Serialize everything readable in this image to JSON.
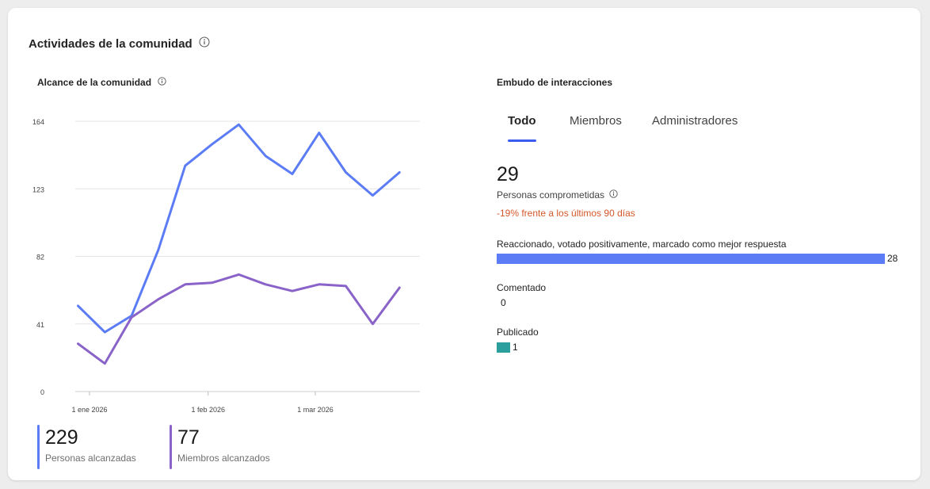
{
  "card": {
    "title": "Actividades de la comunidad"
  },
  "reach": {
    "title": "Alcance de la comunidad",
    "stats": [
      {
        "value": "229",
        "label": "Personas alcanzadas",
        "color": "#5b7cf5"
      },
      {
        "value": "77",
        "label": "Miembros alcanzados",
        "color": "#8a63c9"
      }
    ]
  },
  "chart_data": {
    "type": "line",
    "y_ticks": [
      "164",
      "123",
      "82",
      "41",
      "0"
    ],
    "ylim": [
      0,
      164
    ],
    "x_ticks": [
      "1 ene 2026",
      "1 feb 2026",
      "1 mar 2026"
    ],
    "x": [
      "2025-12-29",
      "2026-01-05",
      "2026-01-12",
      "2026-01-19",
      "2026-01-26",
      "2026-02-02",
      "2026-02-09",
      "2026-02-16",
      "2026-02-23",
      "2026-03-02",
      "2026-03-09",
      "2026-03-16",
      "2026-03-23",
      "2026-03-30"
    ],
    "series": [
      {
        "color": "#5b7cf5",
        "values": [
          52,
          36,
          46,
          86,
          137,
          150,
          162,
          143,
          132,
          157,
          133,
          119,
          133
        ]
      },
      {
        "color": "#8a63c9",
        "values": [
          29,
          17,
          45,
          56,
          65,
          66,
          71,
          65,
          61,
          65,
          64,
          41,
          63
        ]
      }
    ]
  },
  "funnel": {
    "title": "Embudo de interacciones",
    "tabs": [
      "Todo",
      "Miembros",
      "Administradores"
    ],
    "active_tab": "Todo",
    "engaged_value": "29",
    "engaged_label": "Personas comprometidas",
    "change_text": "-19% frente a los últimos 90 días",
    "rows": [
      {
        "label": "Reaccionado, votado positivamente, marcado como mejor respuesta",
        "value": 28,
        "value_text": "28",
        "color": "#5b7cf5"
      },
      {
        "label": "Comentado",
        "value": 0,
        "value_text": "0",
        "color": "#5b7cf5"
      },
      {
        "label": "Publicado",
        "value": 1,
        "value_text": "1",
        "color": "#2b9e9e"
      }
    ],
    "max": 28,
    "colors": {
      "accent": "#3a5bf0",
      "change": "#d4582a"
    }
  }
}
